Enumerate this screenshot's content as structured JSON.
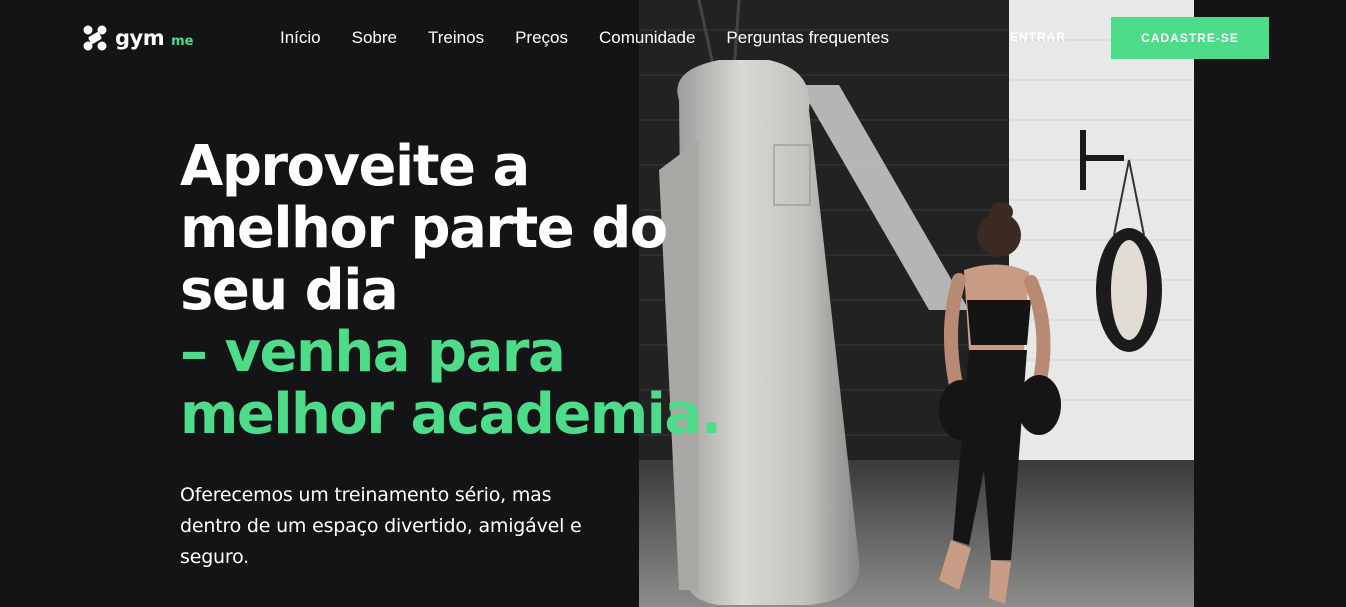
{
  "brand": {
    "name": "gym",
    "suffix": "me"
  },
  "nav": [
    {
      "label": "Início"
    },
    {
      "label": "Sobre"
    },
    {
      "label": "Treinos"
    },
    {
      "label": "Preços"
    },
    {
      "label": "Comunidade"
    },
    {
      "label": "Perguntas frequentes"
    }
  ],
  "actions": {
    "login": "ENTRAR",
    "signup": "CADASTRE-SE"
  },
  "hero": {
    "headline_lines": [
      "Aproveite a",
      "melhor parte do",
      "seu dia"
    ],
    "highlight_lines": [
      "– venha para",
      "melhor academia."
    ],
    "subtitle": "Oferecemos um treinamento sério, mas dentro de um espaço divertido, amigável e seguro."
  },
  "colors": {
    "accent": "#4ddc8a",
    "background": "#141316",
    "text": "#ffffff"
  }
}
